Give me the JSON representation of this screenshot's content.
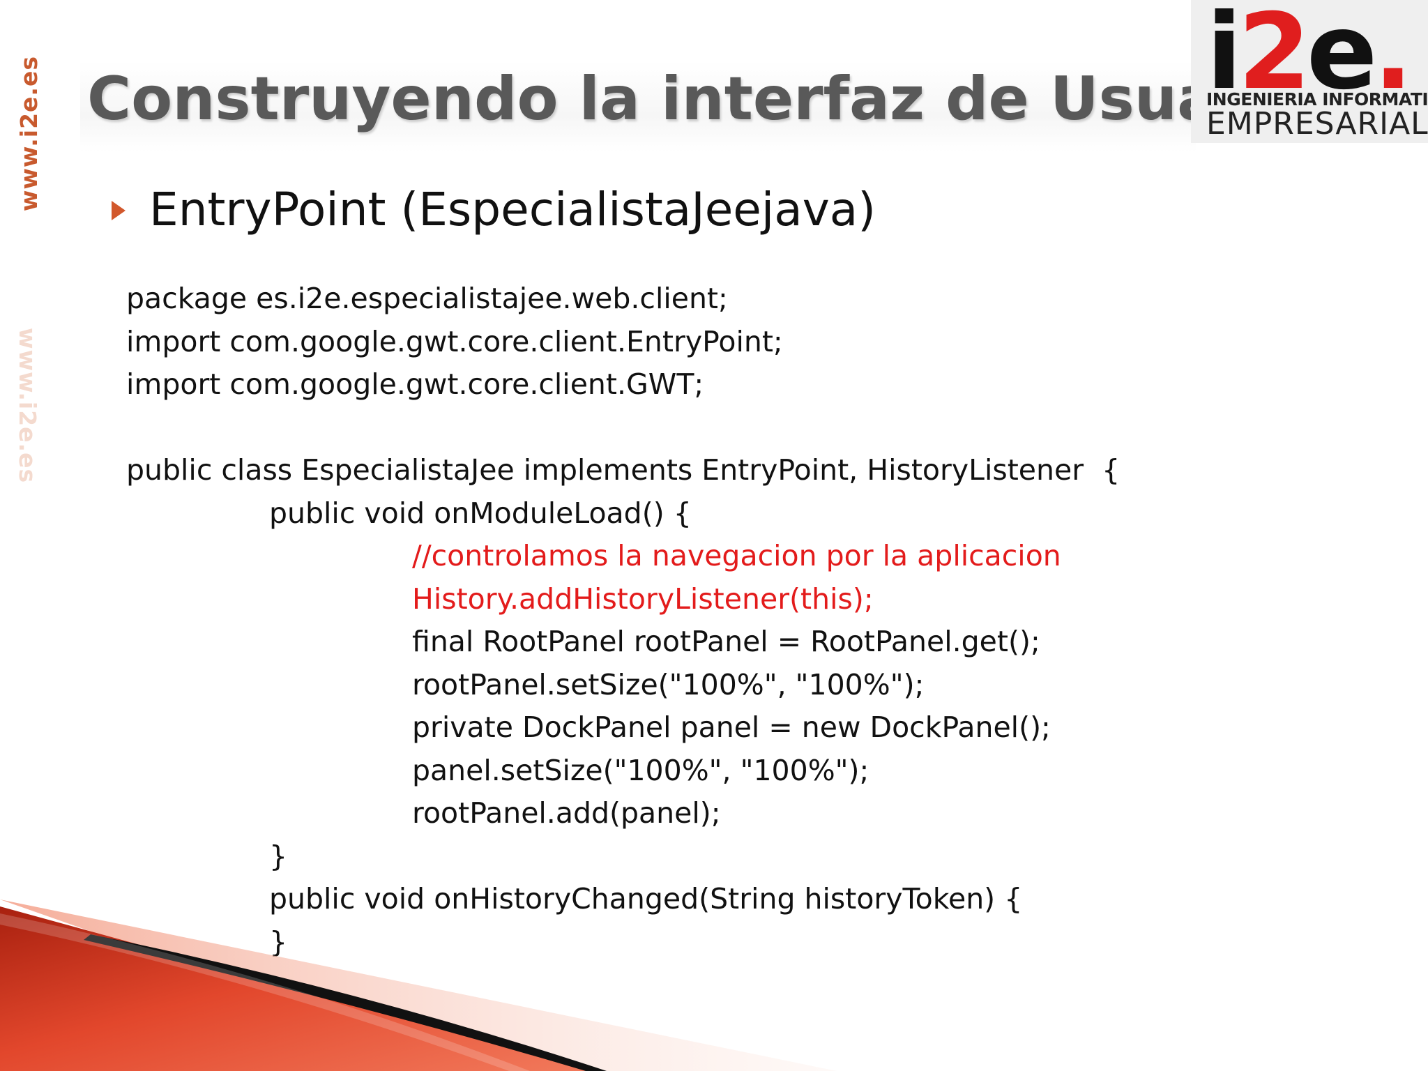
{
  "side": {
    "url": "www.i2e.es"
  },
  "title": "Construyendo la interfaz de Usuario",
  "logo": {
    "mark_i": "i",
    "mark_2": "2",
    "mark_e": "e",
    "mark_dot": ".",
    "line1": "INGENIERIA INFORMATICA",
    "line2": "EMPRESARIAL"
  },
  "bullet": {
    "text": "EntryPoint (EspecialistaJeejava)",
    "icon": "triangle-bullet-icon"
  },
  "code": [
    {
      "text": "package es.i2e.especialistajee.web.client;",
      "indent": 0,
      "highlight": false
    },
    {
      "text": "import com.google.gwt.core.client.EntryPoint;",
      "indent": 0,
      "highlight": false
    },
    {
      "text": "import com.google.gwt.core.client.GWT;",
      "indent": 0,
      "highlight": false
    },
    {
      "text": "",
      "indent": 0,
      "highlight": false
    },
    {
      "text": "public class EspecialistaJee implements EntryPoint, HistoryListener  {",
      "indent": 0,
      "highlight": false
    },
    {
      "text": "public void onModuleLoad() {",
      "indent": 1,
      "highlight": false
    },
    {
      "text": "//controlamos la navegacion por la aplicacion",
      "indent": 2,
      "highlight": true
    },
    {
      "text": "History.addHistoryListener(this);",
      "indent": 2,
      "highlight": true
    },
    {
      "text": "final RootPanel rootPanel = RootPanel.get();",
      "indent": 2,
      "highlight": false
    },
    {
      "text": "rootPanel.setSize(\"100%\", \"100%\");",
      "indent": 2,
      "highlight": false
    },
    {
      "text": "private DockPanel panel = new DockPanel();",
      "indent": 2,
      "highlight": false
    },
    {
      "text": "panel.setSize(\"100%\", \"100%\");",
      "indent": 2,
      "highlight": false
    },
    {
      "text": "rootPanel.add(panel);",
      "indent": 2,
      "highlight": false
    },
    {
      "text": "}",
      "indent": 1,
      "highlight": false
    },
    {
      "text": "public void onHistoryChanged(String historyToken) {",
      "indent": 1,
      "highlight": false
    },
    {
      "text": "}",
      "indent": 1,
      "highlight": false
    },
    {
      "text": "}",
      "indent": 0,
      "highlight": false
    }
  ],
  "colors": {
    "accent": "#d2582c",
    "highlight_code": "#e31b1b",
    "title": "#595959",
    "swoosh_red": "#c0301c",
    "swoosh_dark": "#111111"
  }
}
